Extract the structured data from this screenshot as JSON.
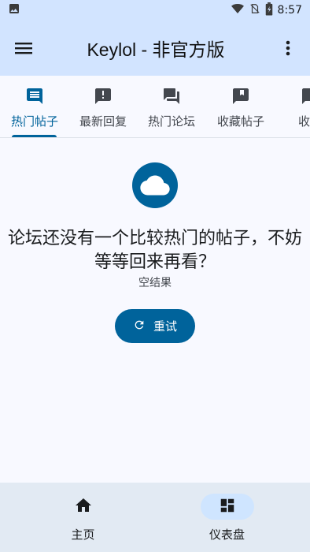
{
  "status_bar": {
    "time": "8:57",
    "icons": [
      "image-icon",
      "wifi-icon",
      "sim-off-icon",
      "battery-charging-icon"
    ]
  },
  "app_bar": {
    "title": "Keylol - 非官方版",
    "menu_icon": "hamburger-menu-icon",
    "overflow_icon": "more-vert-icon"
  },
  "tabs": [
    {
      "label": "热门帖子",
      "icon": "comment-icon",
      "active": true
    },
    {
      "label": "最新回复",
      "icon": "announcement-icon",
      "active": false
    },
    {
      "label": "热门论坛",
      "icon": "forum-icon",
      "active": false
    },
    {
      "label": "收藏帖子",
      "icon": "bookmark-icon",
      "active": false
    },
    {
      "label": "收藏",
      "icon": "bookmark-icon",
      "active": false
    }
  ],
  "empty_state": {
    "icon": "cloud-icon",
    "title": "论坛还没有一个比较热门的帖子，不妨等等回来再看？",
    "subtitle": "空结果",
    "retry_label": "重试",
    "retry_icon": "refresh-icon"
  },
  "bottom_nav": [
    {
      "label": "主页",
      "icon": "home-icon",
      "active": false
    },
    {
      "label": "仪表盘",
      "icon": "dashboard-icon",
      "active": true
    }
  ],
  "colors": {
    "primary": "#00639b",
    "app_bar_bg": "#d2e4ff",
    "background": "#f8f9ff",
    "bottom_nav_bg": "#e2eaf3",
    "nav_active_pill": "#cfe5ff"
  }
}
